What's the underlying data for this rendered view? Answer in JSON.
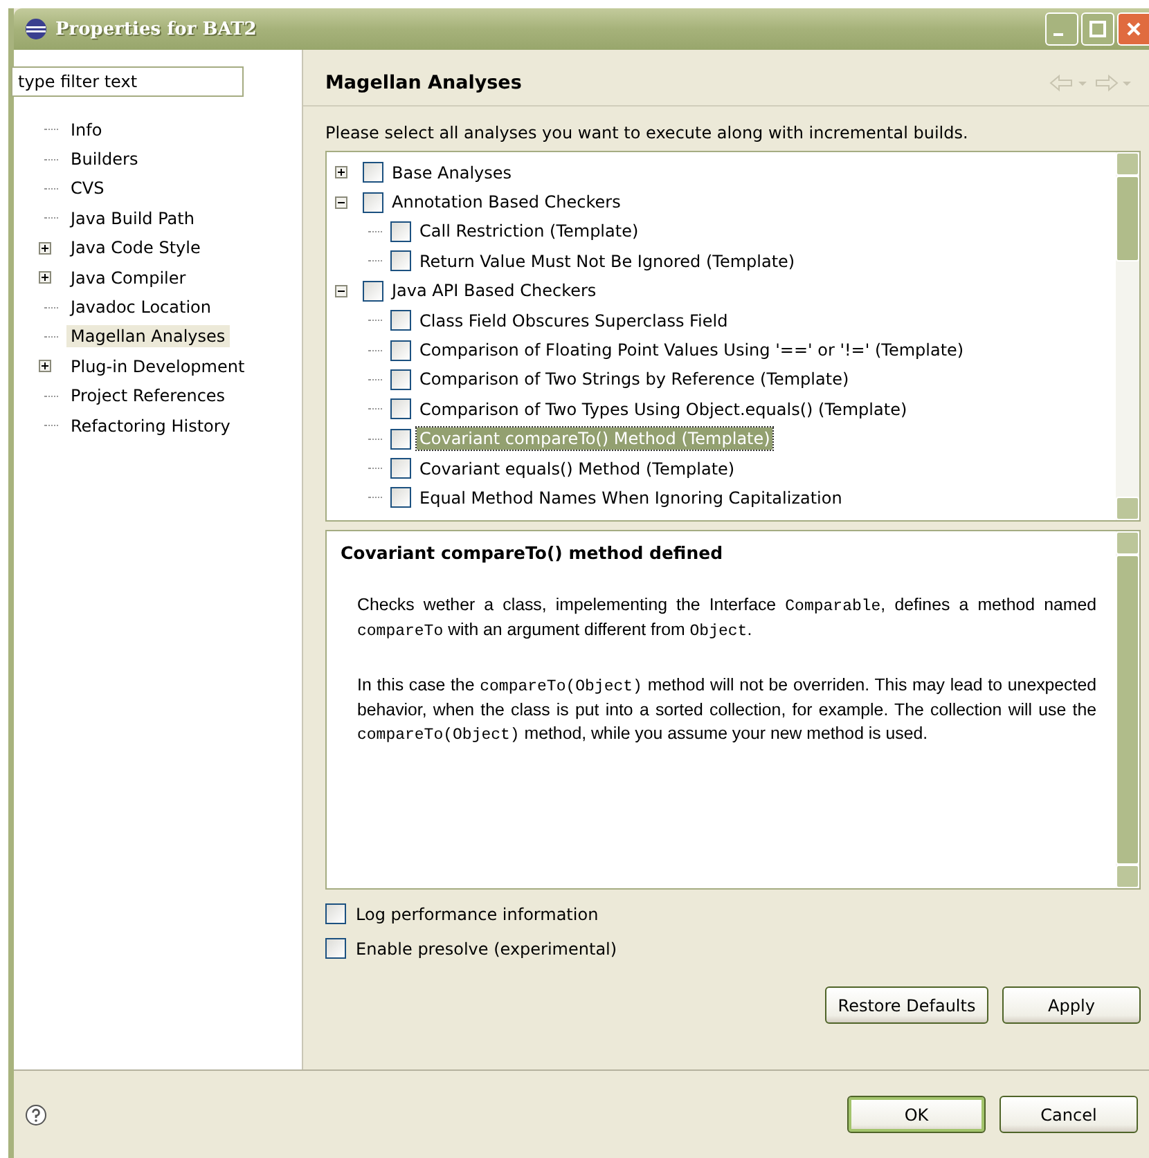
{
  "window": {
    "title": "Properties for BAT2"
  },
  "filter": {
    "placeholder": "type filter text"
  },
  "sidebar": {
    "items": [
      {
        "label": "Info",
        "expandable": false,
        "selected": false
      },
      {
        "label": "Builders",
        "expandable": false,
        "selected": false
      },
      {
        "label": "CVS",
        "expandable": false,
        "selected": false
      },
      {
        "label": "Java Build Path",
        "expandable": false,
        "selected": false
      },
      {
        "label": "Java Code Style",
        "expandable": true,
        "selected": false
      },
      {
        "label": "Java Compiler",
        "expandable": true,
        "selected": false
      },
      {
        "label": "Javadoc Location",
        "expandable": false,
        "selected": false
      },
      {
        "label": "Magellan Analyses",
        "expandable": false,
        "selected": true
      },
      {
        "label": "Plug-in Development",
        "expandable": true,
        "selected": false
      },
      {
        "label": "Project References",
        "expandable": false,
        "selected": false
      },
      {
        "label": "Refactoring History",
        "expandable": false,
        "selected": false
      }
    ]
  },
  "page": {
    "title": "Magellan Analyses",
    "instruction": "Please select all analyses you want to execute along with incremental builds."
  },
  "analyses": [
    {
      "label": "Base Analyses",
      "checked": false,
      "selected": false,
      "expanded": false
    },
    {
      "label": "Annotation Based Checkers",
      "checked": false,
      "selected": false,
      "expanded": true,
      "children": [
        {
          "label": "Call Restriction (Template)",
          "checked": false,
          "selected": false
        },
        {
          "label": "Return Value Must Not Be Ignored (Template)",
          "checked": false,
          "selected": false
        }
      ]
    },
    {
      "label": "Java API Based Checkers",
      "checked": false,
      "selected": false,
      "expanded": true,
      "children": [
        {
          "label": "Class Field Obscures Superclass Field",
          "checked": false,
          "selected": false
        },
        {
          "label": "Comparison of Floating Point Values Using '==' or '!=' (Template)",
          "checked": false,
          "selected": false
        },
        {
          "label": "Comparison of Two Strings by Reference (Template)",
          "checked": false,
          "selected": false
        },
        {
          "label": "Comparison of Two Types Using Object.equals() (Template)",
          "checked": false,
          "selected": false
        },
        {
          "label": "Covariant compareTo() Method (Template)",
          "checked": false,
          "selected": true
        },
        {
          "label": "Covariant equals() Method (Template)",
          "checked": false,
          "selected": false
        },
        {
          "label": "Equal Method Names When Ignoring Capitalization",
          "checked": false,
          "selected": false
        }
      ]
    }
  ],
  "description": {
    "title": "Covariant compareTo() method defined",
    "paragraphs": [
      [
        {
          "kind": "text",
          "text": "Checks wether a class, impelementing the Interface "
        },
        {
          "kind": "code",
          "text": "Comparable"
        },
        {
          "kind": "text",
          "text": ", defines a method named "
        },
        {
          "kind": "code",
          "text": "compareTo"
        },
        {
          "kind": "text",
          "text": " with an argument different from "
        },
        {
          "kind": "code",
          "text": "Object"
        },
        {
          "kind": "text",
          "text": "."
        }
      ],
      [
        {
          "kind": "text",
          "text": "In this case the "
        },
        {
          "kind": "code",
          "text": "compareTo(Object)"
        },
        {
          "kind": "text",
          "text": " method will not be overriden. This may lead to unexpected behavior, when the class is put into a sorted collection, for example. The collection will use the "
        },
        {
          "kind": "code",
          "text": "compareTo(Object)"
        },
        {
          "kind": "text",
          "text": " method, while you assume your new method is used."
        }
      ]
    ]
  },
  "options": [
    {
      "label": "Log performance information",
      "checked": false
    },
    {
      "label": "Enable presolve (experimental)",
      "checked": false
    }
  ],
  "page_buttons": [
    "Restore Defaults",
    "Apply"
  ],
  "dialog_buttons": [
    {
      "label": "OK",
      "default": true
    },
    {
      "label": "Cancel",
      "default": false
    }
  ]
}
